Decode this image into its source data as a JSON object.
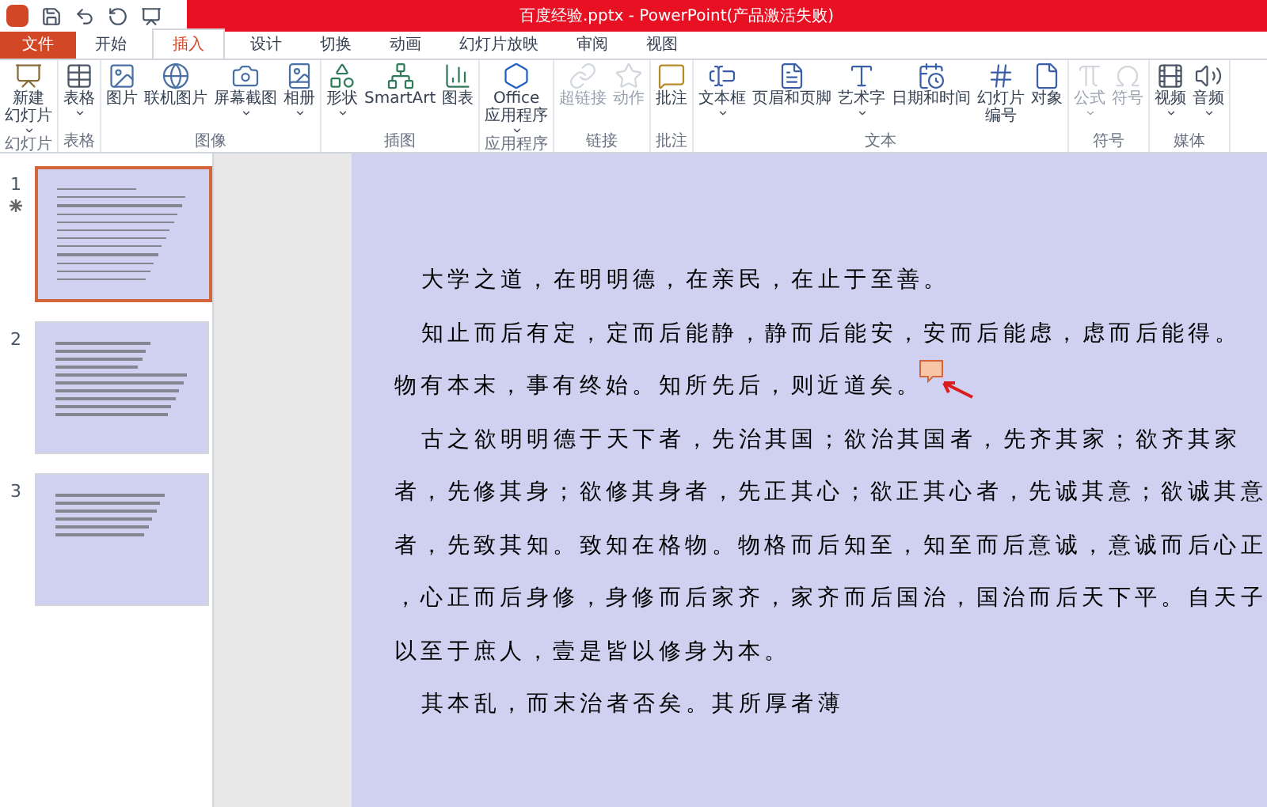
{
  "window": {
    "title": "百度经验.pptx - PowerPoint(产品激活失败)"
  },
  "tabs": [
    {
      "label": "文件",
      "kind": "file",
      "selected": false
    },
    {
      "label": "开始",
      "kind": "tab",
      "selected": false
    },
    {
      "label": "插入",
      "kind": "tab",
      "selected": true
    },
    {
      "label": "设计",
      "kind": "tab",
      "selected": false
    },
    {
      "label": "切换",
      "kind": "tab",
      "selected": false
    },
    {
      "label": "动画",
      "kind": "tab",
      "selected": false
    },
    {
      "label": "幻灯片放映",
      "kind": "tab",
      "selected": false
    },
    {
      "label": "审阅",
      "kind": "tab",
      "selected": false
    },
    {
      "label": "视图",
      "kind": "tab",
      "selected": false
    }
  ],
  "ribbon": [
    {
      "label": "幻灯片",
      "buttons": [
        {
          "lines": [
            "新建",
            "幻灯片"
          ],
          "dropdown": true,
          "disabled": false
        }
      ]
    },
    {
      "label": "表格",
      "buttons": [
        {
          "lines": [
            "表格"
          ],
          "dropdown": true,
          "disabled": false
        }
      ]
    },
    {
      "label": "图像",
      "buttons": [
        {
          "lines": [
            "图片"
          ],
          "dropdown": false,
          "disabled": false
        },
        {
          "lines": [
            "联机图片"
          ],
          "dropdown": false,
          "disabled": false
        },
        {
          "lines": [
            "屏幕截图"
          ],
          "dropdown": true,
          "disabled": false
        },
        {
          "lines": [
            "相册"
          ],
          "dropdown": true,
          "disabled": false
        }
      ]
    },
    {
      "label": "插图",
      "buttons": [
        {
          "lines": [
            "形状"
          ],
          "dropdown": true,
          "disabled": false
        },
        {
          "lines": [
            "SmartArt"
          ],
          "dropdown": false,
          "disabled": false
        },
        {
          "lines": [
            "图表"
          ],
          "dropdown": false,
          "disabled": false
        }
      ]
    },
    {
      "label": "应用程序",
      "buttons": [
        {
          "lines": [
            "Office",
            "应用程序"
          ],
          "dropdown": true,
          "disabled": false
        }
      ]
    },
    {
      "label": "链接",
      "buttons": [
        {
          "lines": [
            "超链接"
          ],
          "dropdown": false,
          "disabled": true
        },
        {
          "lines": [
            "动作"
          ],
          "dropdown": false,
          "disabled": true
        }
      ]
    },
    {
      "label": "批注",
      "buttons": [
        {
          "lines": [
            "批注"
          ],
          "dropdown": false,
          "disabled": false
        }
      ]
    },
    {
      "label": "文本",
      "buttons": [
        {
          "lines": [
            "文本框"
          ],
          "dropdown": true,
          "disabled": false
        },
        {
          "lines": [
            "页眉和页脚"
          ],
          "dropdown": false,
          "disabled": false
        },
        {
          "lines": [
            "艺术字"
          ],
          "dropdown": true,
          "disabled": false
        },
        {
          "lines": [
            "日期和时间"
          ],
          "dropdown": false,
          "disabled": false
        },
        {
          "lines": [
            "幻灯片",
            "编号"
          ],
          "dropdown": false,
          "disabled": false
        },
        {
          "lines": [
            "对象"
          ],
          "dropdown": false,
          "disabled": false
        }
      ]
    },
    {
      "label": "符号",
      "buttons": [
        {
          "lines": [
            "公式"
          ],
          "dropdown": true,
          "disabled": true
        },
        {
          "lines": [
            "符号"
          ],
          "dropdown": false,
          "disabled": true
        }
      ]
    },
    {
      "label": "媒体",
      "buttons": [
        {
          "lines": [
            "视频"
          ],
          "dropdown": true,
          "disabled": false
        },
        {
          "lines": [
            "音频"
          ],
          "dropdown": true,
          "disabled": false
        }
      ]
    }
  ],
  "thumbnails": [
    {
      "number": "1",
      "selected": true,
      "animated": true
    },
    {
      "number": "2",
      "selected": false,
      "animated": false
    },
    {
      "number": "3",
      "selected": false,
      "animated": false
    }
  ],
  "slide": {
    "lines": [
      {
        "text": "大学之道，在明明德，在亲民，在止于至善。",
        "indent": true,
        "comment": false
      },
      {
        "text": "知止而后有定，定而后能静，静而后能安，安而后能虑，虑而后能得。",
        "indent": true,
        "comment": false
      },
      {
        "text": "物有本末，事有终始。知所先后，则近道矣。",
        "indent": false,
        "comment": true
      },
      {
        "text": "古之欲明明德于天下者，先治其国；欲治其国者，先齐其家；欲齐其家",
        "indent": true,
        "comment": false
      },
      {
        "text": "者，先修其身；欲修其身者，先正其心；欲正其心者，先诚其意；欲诚其意",
        "indent": false,
        "comment": false
      },
      {
        "text": "者，先致其知。致知在格物。物格而后知至，知至而后意诚，意诚而后心正",
        "indent": false,
        "comment": false
      },
      {
        "text": "，心正而后身修，身修而后家齐，家齐而后国治，国治而后天下平。自天子",
        "indent": false,
        "comment": false
      },
      {
        "text": "以至于庶人，壹是皆以修身为本。",
        "indent": false,
        "comment": false
      },
      {
        "text": "其本乱，而末治者否矣。其所厚者薄",
        "indent": true,
        "comment": false
      }
    ]
  }
}
